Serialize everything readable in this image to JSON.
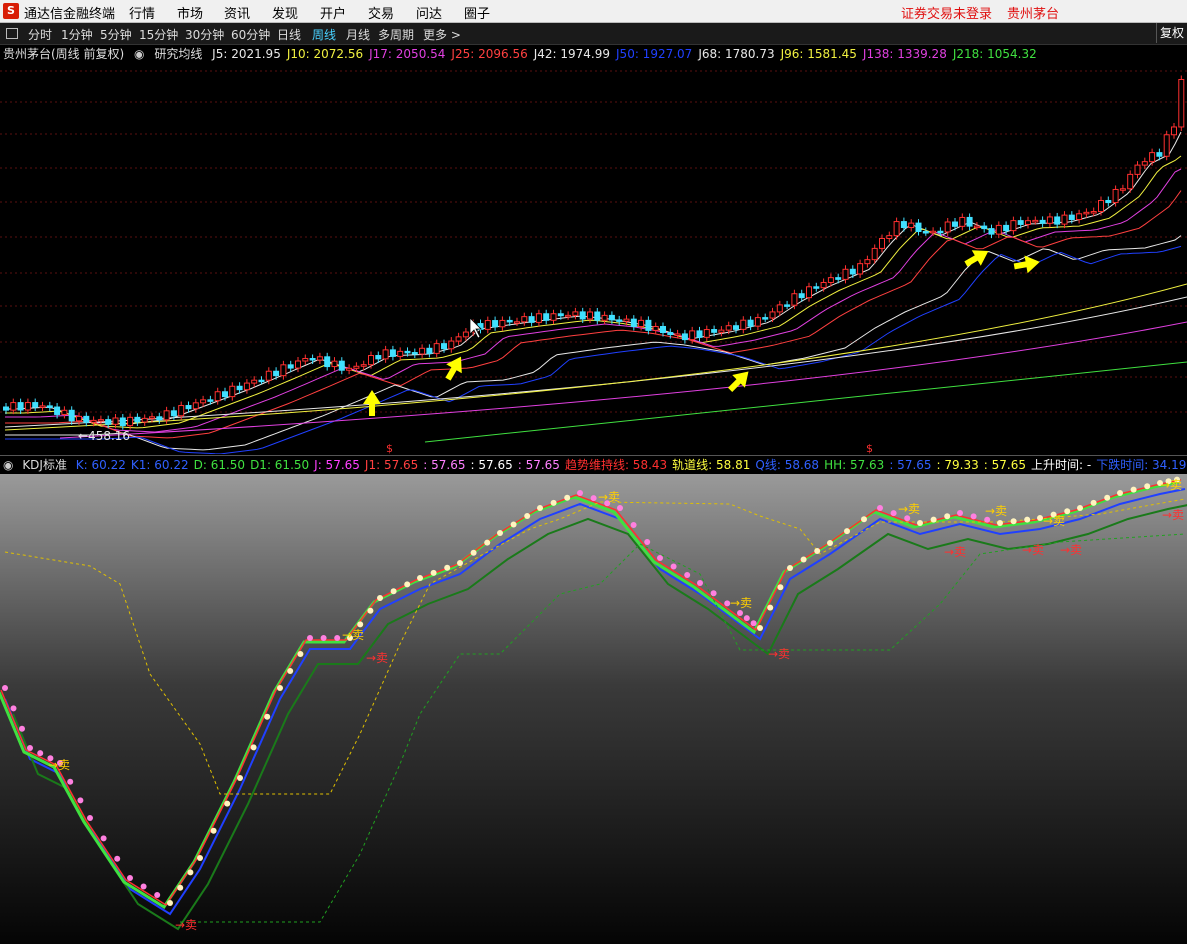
{
  "menubar": {
    "logo": "S",
    "app_title": "通达信金融终端",
    "menus": [
      "行情",
      "市场",
      "资讯",
      "发现",
      "开户",
      "交易",
      "问达",
      "圈子"
    ],
    "login_status": "证券交易未登录",
    "stock_name": "贵州茅台"
  },
  "toolbar": {
    "periods": [
      "分时",
      "1分钟",
      "5分钟",
      "15分钟",
      "30分钟",
      "60分钟",
      "日线",
      "周线",
      "月线",
      "多周期",
      "更多 >"
    ],
    "active_period": "周线",
    "restore_button": "复权"
  },
  "chart_header": {
    "title": "贵州茅台(周线 前复权)",
    "indicator": "研究均线",
    "mas": [
      {
        "label": "J5: 2021.95",
        "color": "#e8e8e8"
      },
      {
        "label": "J10: 2072.56",
        "color": "#f0f040"
      },
      {
        "label": "J17: 2050.54",
        "color": "#e040e0"
      },
      {
        "label": "J25: 2096.56",
        "color": "#ff4040"
      },
      {
        "label": "J42: 1974.99",
        "color": "#e8e8e8"
      },
      {
        "label": "J50: 1927.07",
        "color": "#2040ff"
      },
      {
        "label": "J68: 1780.73",
        "color": "#e8e8e8"
      },
      {
        "label": "J96: 1581.45",
        "color": "#f0f040"
      },
      {
        "label": "J138: 1339.28",
        "color": "#e040e0"
      },
      {
        "label": "J218: 1054.32",
        "color": "#40e040"
      }
    ],
    "low_label": "←458.16",
    "signal_markers": [
      "$",
      "$"
    ]
  },
  "kdj_header": {
    "name": "KDJ标准",
    "values": [
      {
        "label": "K: 60.22",
        "color": "#3060ff"
      },
      {
        "label": "K1: 60.22",
        "color": "#3060ff"
      },
      {
        "label": "D: 61.50",
        "color": "#40e040"
      },
      {
        "label": "D1: 61.50",
        "color": "#40e040"
      },
      {
        "label": "J: 57.65",
        "color": "#ff40ff"
      },
      {
        "label": "J1: 57.65",
        "color": "#ff4040"
      },
      {
        "label": ": 57.65",
        "color": "#ff80ff"
      },
      {
        "label": ": 57.65",
        "color": "#ffffff"
      },
      {
        "label": ": 57.65",
        "color": "#ff80ff"
      },
      {
        "label": "趋势维持线: 58.43",
        "color": "#ff3030"
      },
      {
        "label": "轨道线: 58.81",
        "color": "#ffff40"
      },
      {
        "label": "Q线: 58.68",
        "color": "#3060ff"
      },
      {
        "label": "HH: 57.63",
        "color": "#40e040"
      },
      {
        "label": ": 57.65",
        "color": "#3060ff"
      },
      {
        "label": ": 79.33",
        "color": "#ffff40"
      },
      {
        "label": ": 57.65",
        "color": "#ffff40"
      },
      {
        "label": "上升时间: -",
        "color": "#ffffff"
      },
      {
        "label": "下跌时间: 34.19",
        "color": "#3060ff"
      }
    ],
    "sell_label": "→卖"
  },
  "colors": {
    "up": "#ff3030",
    "down": "#40e0ff",
    "background": "#000000"
  }
}
